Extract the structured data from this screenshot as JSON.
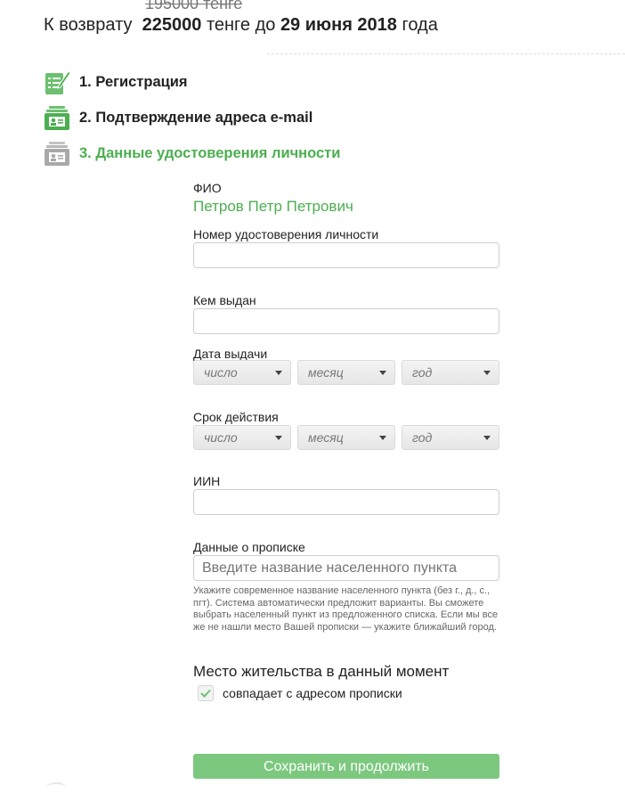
{
  "header": {
    "old_price": "195000 тенге",
    "refund_prefix": "К возврату",
    "refund_amount": "225000",
    "refund_mid": "тенге до",
    "refund_date": "29 июня 2018",
    "refund_suffix": "года"
  },
  "steps": [
    {
      "label": "1. Регистрация",
      "icon": "checklist-pen-icon",
      "status": "done"
    },
    {
      "label": "2. Подтверждение адреса e-mail",
      "icon": "id-card-icon",
      "status": "done"
    },
    {
      "label": "3. Данные удостоверения личности",
      "icon": "id-card-icon",
      "status": "active"
    }
  ],
  "form": {
    "fio_label": "ФИО",
    "fio_value": "Петров Петр Петрович",
    "id_number_label": "Номер удостоверения личности",
    "id_number_value": "",
    "issued_by_label": "Кем выдан",
    "issued_by_value": "",
    "issue_date_label": "Дата выдачи",
    "issue_date": {
      "day": "число",
      "month": "месяц",
      "year": "год"
    },
    "expiry_label": "Срок действия",
    "expiry_date": {
      "day": "число",
      "month": "месяц",
      "year": "год"
    },
    "iin_label": "ИИН",
    "iin_value": "",
    "registration_label": "Данные о прописке",
    "registration_placeholder": "Введите название населенного пункта",
    "registration_hint": "Укажите современное название населенного пункта (без г., д., с., пгт). Система автоматически предложит варианты. Вы сможете выбрать населенный пункт из предложенного списка. Если мы все же не нашли место Вашей прописки — укажите ближайший город.",
    "residence_title": "Место жительства в данный момент",
    "residence_checkbox_label": "совпадает с адресом прописки",
    "residence_checked": true,
    "save_label": "Сохранить и продолжить"
  },
  "colors": {
    "accent": "#4caf50",
    "button": "#7cc87f"
  }
}
